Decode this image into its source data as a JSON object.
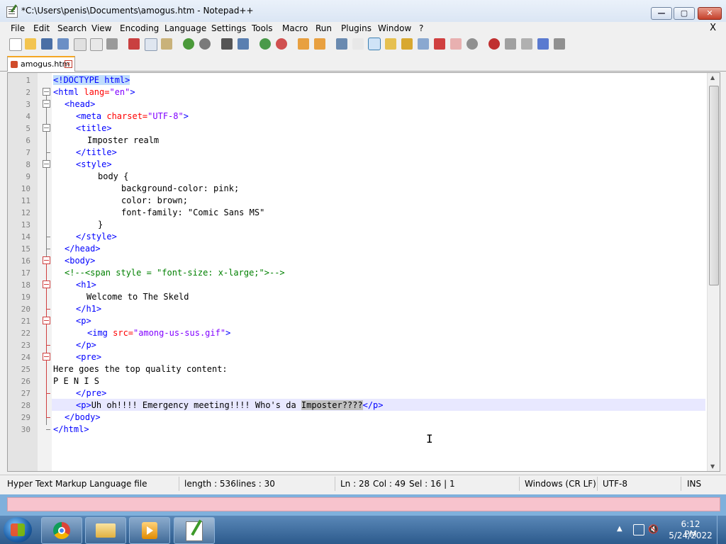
{
  "window": {
    "title": "*C:\\Users\\penis\\Documents\\amogus.htm - Notepad++",
    "minimize": "—",
    "maximize": "▢",
    "close": "✕"
  },
  "menu": {
    "items": [
      "File",
      "Edit",
      "Search",
      "View",
      "Encoding",
      "Language",
      "Settings",
      "Tools",
      "Macro",
      "Run",
      "Plugins",
      "Window",
      "?"
    ],
    "close_x": "X"
  },
  "tabs": [
    {
      "label": "amogus.htm",
      "close": "✕"
    }
  ],
  "editor": {
    "lines": [
      {
        "n": "1"
      },
      {
        "n": "2"
      },
      {
        "n": "3"
      },
      {
        "n": "4"
      },
      {
        "n": "5"
      },
      {
        "n": "6"
      },
      {
        "n": "7"
      },
      {
        "n": "8"
      },
      {
        "n": "9"
      },
      {
        "n": "10"
      },
      {
        "n": "11"
      },
      {
        "n": "12"
      },
      {
        "n": "13"
      },
      {
        "n": "14"
      },
      {
        "n": "15"
      },
      {
        "n": "16"
      },
      {
        "n": "17"
      },
      {
        "n": "18"
      },
      {
        "n": "19"
      },
      {
        "n": "20"
      },
      {
        "n": "21"
      },
      {
        "n": "22"
      },
      {
        "n": "23"
      },
      {
        "n": "24"
      },
      {
        "n": "25"
      },
      {
        "n": "26"
      },
      {
        "n": "27"
      },
      {
        "n": "28"
      },
      {
        "n": "29"
      },
      {
        "n": "30"
      }
    ],
    "code": {
      "l1_doctype": "<!DOCTYPE html>",
      "l2_open": "<html ",
      "l2_attr": "lang=",
      "l2_val": "\"en\"",
      "l2_close": ">",
      "l3": "<head>",
      "l4_open": "<meta ",
      "l4_attr": "charset=",
      "l4_val": "\"UTF-8\"",
      "l4_close": ">",
      "l5": "<title>",
      "l6": "Imposter realm",
      "l7": "</title>",
      "l8": "<style>",
      "l9": "body {",
      "l10": "background-color: pink;",
      "l11": "color: brown;",
      "l12": "font-family: \"Comic Sans MS\"",
      "l13": "}",
      "l14": "</style>",
      "l15": "</head>",
      "l16": "<body>",
      "l17": "<!--<span style = \"font-size: x-large;\">-->",
      "l18": "<h1>",
      "l19": "Welcome to The Skeld",
      "l20": "</h1>",
      "l21": "<p>",
      "l22_open": "<img ",
      "l22_attr": "src=",
      "l22_val": "\"among-us-sus.gif\"",
      "l22_close": ">",
      "l23": "</p>",
      "l24": "<pre>",
      "l25": "Here goes the top quality content:",
      "l26": "P E N I S",
      "l27": "</pre>",
      "l28_open": "<p>",
      "l28_text": "Uh oh!!!! Emergency meeting!!!! Who's da ",
      "l28_sel": "Imposter????",
      "l28_close": "</p>",
      "l29": "</body>",
      "l30": "</html>"
    }
  },
  "status": {
    "file_type": "Hyper Text Markup Language file",
    "length": "length : 536",
    "lines": "lines : 30",
    "ln": "Ln : 28",
    "col": "Col : 49",
    "sel": "Sel : 16 | 1",
    "eol": "Windows (CR LF)",
    "encoding": "UTF-8",
    "mode": "INS"
  },
  "taskbar": {
    "time": "6:12 PM",
    "date": "5/24/2022"
  },
  "colors": {
    "tag": "#0000ff",
    "attr": "#ff0000",
    "value": "#8000ff",
    "comment": "#008000"
  }
}
